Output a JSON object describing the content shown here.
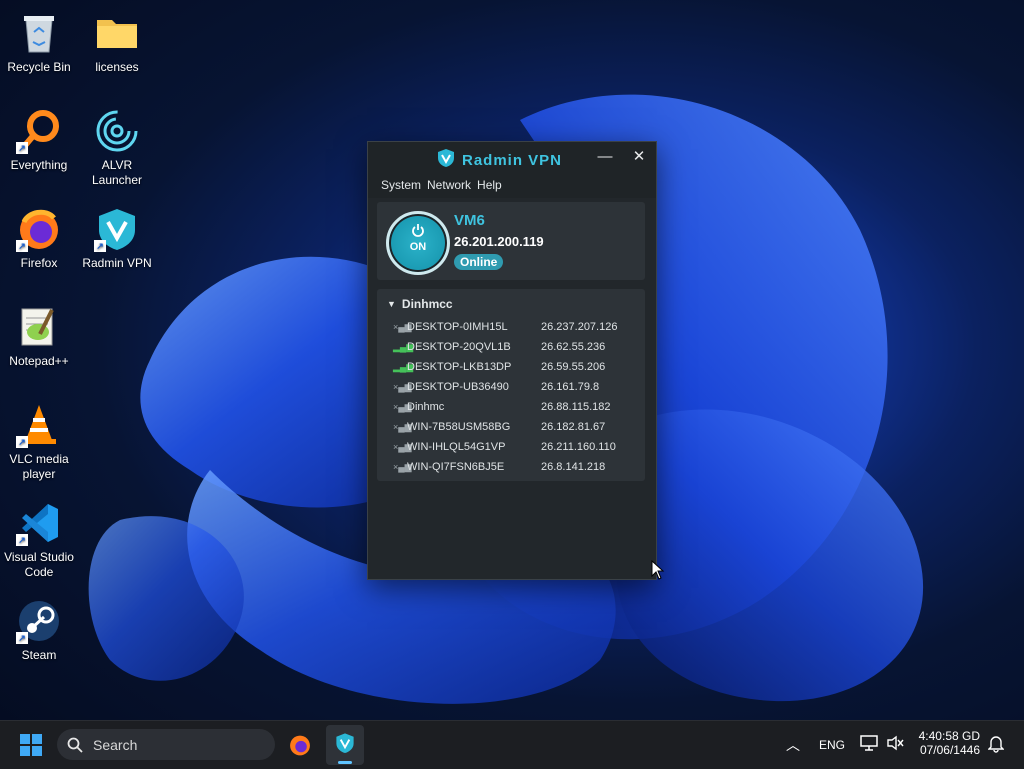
{
  "desktop": {
    "icons": [
      {
        "label": "Recycle Bin"
      },
      {
        "label": "licenses"
      },
      {
        "label": "Everything"
      },
      {
        "label": "ALVR Launcher"
      },
      {
        "label": "Firefox"
      },
      {
        "label": "Radmin VPN"
      },
      {
        "label": "Notepad++"
      },
      {
        "label": "VLC media player"
      },
      {
        "label": "Visual Studio Code"
      },
      {
        "label": "Steam"
      }
    ]
  },
  "window": {
    "title": "Radmin VPN",
    "menu": [
      "System",
      "Network",
      "Help"
    ],
    "status": {
      "power_label": "ON",
      "name": "VM6",
      "ip": "26.201.200.119",
      "state": "Online"
    },
    "network": {
      "name": "Dinhmcc",
      "peers": [
        {
          "name": "DESKTOP-0IMH15L",
          "ip": "26.237.207.126",
          "signal": "x"
        },
        {
          "name": "DESKTOP-20QVL1B",
          "ip": "26.62.55.236",
          "signal": "ok"
        },
        {
          "name": "DESKTOP-LKB13DP",
          "ip": "26.59.55.206",
          "signal": "ok"
        },
        {
          "name": "DESKTOP-UB36490",
          "ip": "26.161.79.8",
          "signal": "x"
        },
        {
          "name": "Dinhmc",
          "ip": "26.88.115.182",
          "signal": "x"
        },
        {
          "name": "WIN-7B58USM58BG",
          "ip": "26.182.81.67",
          "signal": "x"
        },
        {
          "name": "WIN-IHLQL54G1VP",
          "ip": "26.211.160.110",
          "signal": "x"
        },
        {
          "name": "WIN-QI7FSN6BJ5E",
          "ip": "26.8.141.218",
          "signal": "x"
        }
      ]
    }
  },
  "taskbar": {
    "search_placeholder": "Search",
    "lang": "ENG",
    "time": "4:40:58 GD",
    "date": "07/06/1446"
  }
}
